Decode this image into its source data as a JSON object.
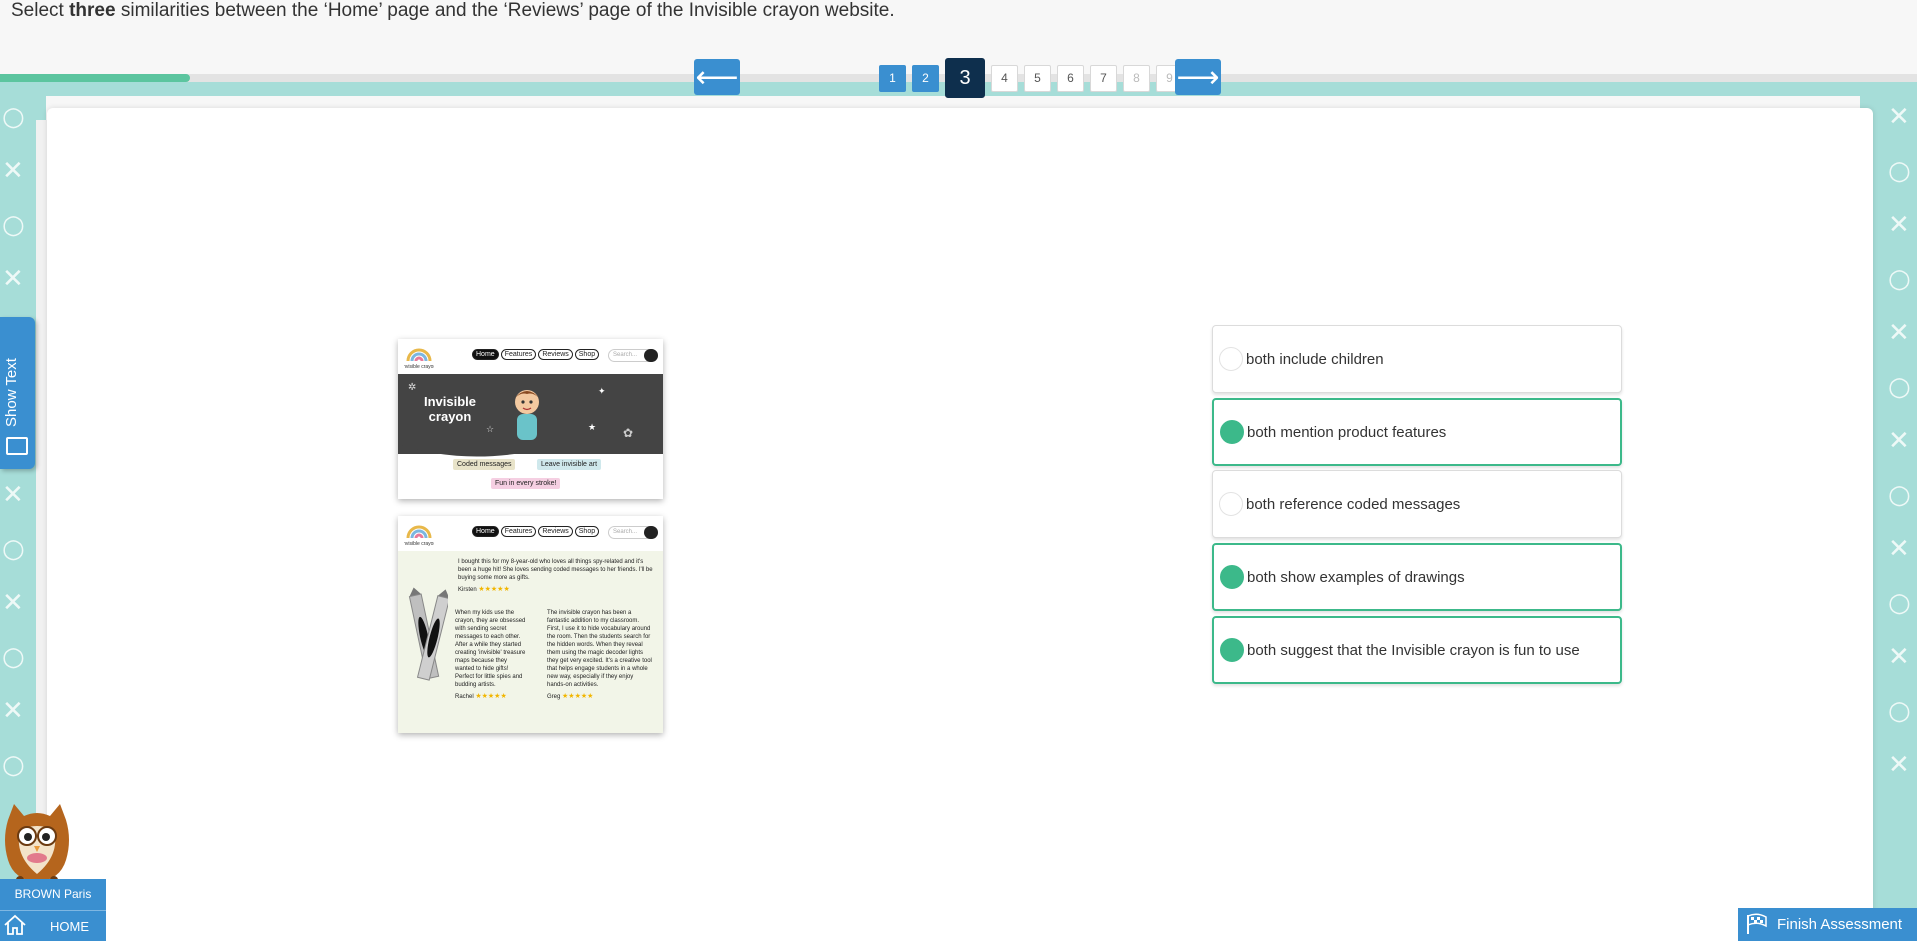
{
  "question": {
    "prefix": "Select ",
    "emphasis": "three",
    "suffix": " similarities between the ‘Home’ page and the ‘Reviews’ page of the Invisible crayon website."
  },
  "navigation": {
    "prev_icon": "arrow-left-icon",
    "next_icon": "arrow-right-icon",
    "pages": [
      "1",
      "2",
      "3",
      "4",
      "5",
      "6",
      "7",
      "8",
      "9"
    ],
    "current_page": 3,
    "progress_fraction": 0.1
  },
  "show_text": {
    "label": "Show Text"
  },
  "home_screenshot": {
    "nav_links": [
      "Home",
      "Features",
      "Reviews",
      "Shop"
    ],
    "search_placeholder": "Search...",
    "logo_text": "Invisible crayon",
    "hero_title": "Invisible crayon",
    "chips": [
      "Coded messages",
      "Leave invisible art",
      "Fun in every stroke!"
    ]
  },
  "reviews_screenshot": {
    "nav_links": [
      "Home",
      "Features",
      "Reviews",
      "Shop"
    ],
    "search_placeholder": "Search...",
    "review1_text": "I bought this for my 8-year-old who loves all things spy-related and it's been a huge hit! She loves sending coded messages to her friends. I'll be buying some more as gifts.",
    "review1_author": "Kirsten",
    "review2_text": "When my kids use the crayon, they are obsessed with sending secret messages to each other. After a while they started creating 'invisible' treasure maps because they wanted to hide gifts! Perfect for little spies and budding artists.",
    "review2_author": "Rachel",
    "review3_text": "The invisible crayon has been a fantastic addition to my classroom. First, I use it to hide vocabulary around the room. Then the students search for the hidden words. When they reveal them using the magic decoder lights they get very excited. It's a creative tool that helps engage students in a whole new way, especially if they enjoy hands-on activities.",
    "review3_author": "Greg",
    "stars": "★★★★★"
  },
  "options": [
    {
      "label": "both include children",
      "selected": false
    },
    {
      "label": "both mention product features",
      "selected": true
    },
    {
      "label": "both reference coded messages",
      "selected": false
    },
    {
      "label": "both show examples of drawings",
      "selected": true
    },
    {
      "label": "both suggest that the Invisible crayon is fun to use",
      "selected": true
    }
  ],
  "user": {
    "name": "BROWN Paris",
    "home_label": "HOME"
  },
  "finish": {
    "label": "Finish Assessment"
  },
  "colors": {
    "accent_blue": "#3a8fd0",
    "selected_green": "#3cb98a",
    "teal_band": "#a6ddd8",
    "current_page_navy": "#0e2f4d"
  }
}
